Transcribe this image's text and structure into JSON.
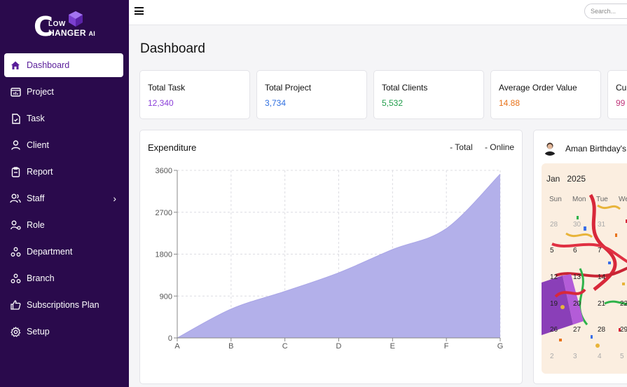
{
  "brand": {
    "logo_c": "C",
    "logo_low": "LOW",
    "logo_hanger": "HANGER",
    "logo_ai": "AI"
  },
  "sidebar": {
    "items": [
      {
        "label": "Dashboard",
        "icon": "home-icon",
        "active": true
      },
      {
        "label": "Project",
        "icon": "project-icon"
      },
      {
        "label": "Task",
        "icon": "task-icon"
      },
      {
        "label": "Client",
        "icon": "user-icon"
      },
      {
        "label": "Report",
        "icon": "clipboard-icon"
      },
      {
        "label": "Staff",
        "icon": "users-icon",
        "chevron": "›"
      },
      {
        "label": "Role",
        "icon": "role-icon"
      },
      {
        "label": "Department",
        "icon": "department-icon"
      },
      {
        "label": "Branch",
        "icon": "branch-icon"
      },
      {
        "label": "Subscriptions Plan",
        "icon": "thumbs-up-icon"
      },
      {
        "label": "Setup",
        "icon": "gear-icon"
      }
    ]
  },
  "topbar": {
    "search_placeholder": "Search..."
  },
  "page": {
    "title": "Dashboard"
  },
  "stats": [
    {
      "label": "Total Task",
      "value": "12,340",
      "color": "#8b3fd9"
    },
    {
      "label": "Total Project",
      "value": "3,734",
      "color": "#2f6fe0"
    },
    {
      "label": "Total Clients",
      "value": "5,532",
      "color": "#1f9d4a"
    },
    {
      "label": "Average Order Value",
      "value": "14.88",
      "color": "#e8731a"
    },
    {
      "label": "Cu",
      "value": "99",
      "color": "#c0357a"
    }
  ],
  "chart_data": {
    "type": "area",
    "title": "Expenditure",
    "legend": [
      "- Total",
      "- Online"
    ],
    "categories": [
      "A",
      "B",
      "C",
      "D",
      "E",
      "F",
      "G"
    ],
    "series": [
      {
        "name": "Total",
        "values": [
          0,
          620,
          1000,
          1400,
          1900,
          2350,
          3520
        ]
      }
    ],
    "yticks": [
      "0",
      "900",
      "1800",
      "2700",
      "3600"
    ],
    "ylim": [
      0,
      3600
    ],
    "fill_color": "#b3b0ea",
    "grid": true
  },
  "birthday": {
    "title": "Aman Birthday's",
    "month": "Jan",
    "year": "2025",
    "weekdays": [
      "Sun",
      "Mon",
      "Tue",
      "We"
    ],
    "weeks": [
      [
        "28",
        "30",
        "31",
        ""
      ],
      [
        "5",
        "6",
        "7",
        ""
      ],
      [
        "12",
        "13",
        "14",
        ""
      ],
      [
        "19",
        "20",
        "21",
        "22"
      ],
      [
        "26",
        "27",
        "28",
        "29"
      ],
      [
        "2",
        "3",
        "4",
        "5"
      ]
    ]
  }
}
